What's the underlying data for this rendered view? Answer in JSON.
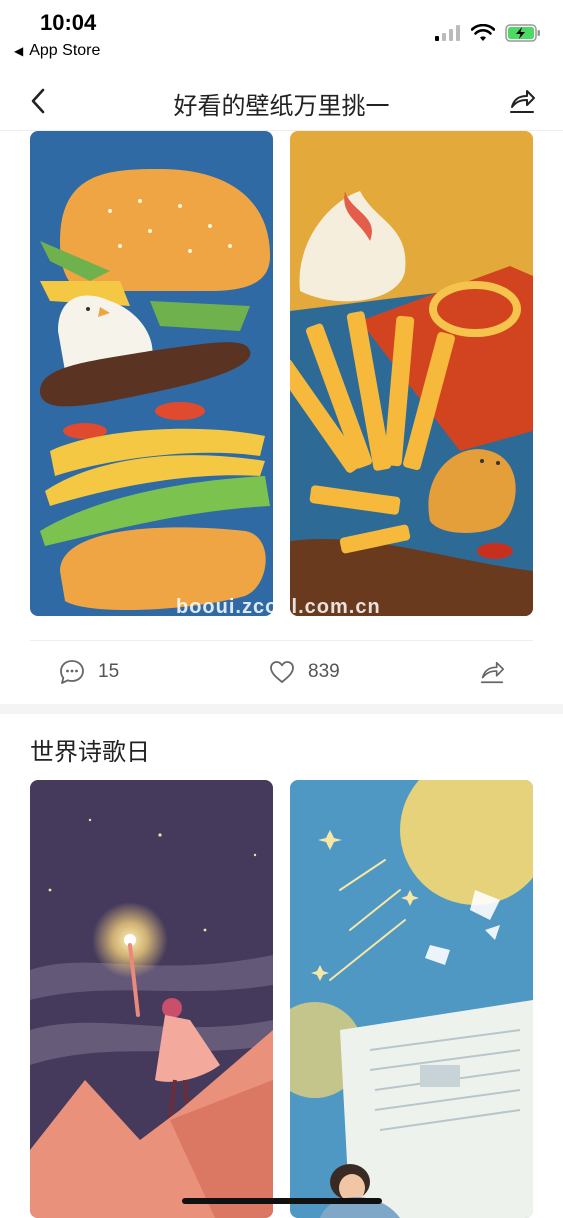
{
  "status": {
    "time": "10:04",
    "back_app": "App Store"
  },
  "nav": {
    "title": "好看的壁纸万里挑一"
  },
  "post1": {
    "watermark": "booui.zcool.com.cn",
    "comments": "15",
    "likes": "839"
  },
  "post2": {
    "title": "世界诗歌日"
  },
  "icons": {
    "back": "chevron-left-icon",
    "share": "share-icon",
    "comment": "comment-icon",
    "like": "heart-icon"
  },
  "colors": {
    "burger_bg": "#2f6aa4",
    "fries_bg": "#e3a93a",
    "night_bg": "#453a5c",
    "sky_bg": "#4f98c4"
  }
}
